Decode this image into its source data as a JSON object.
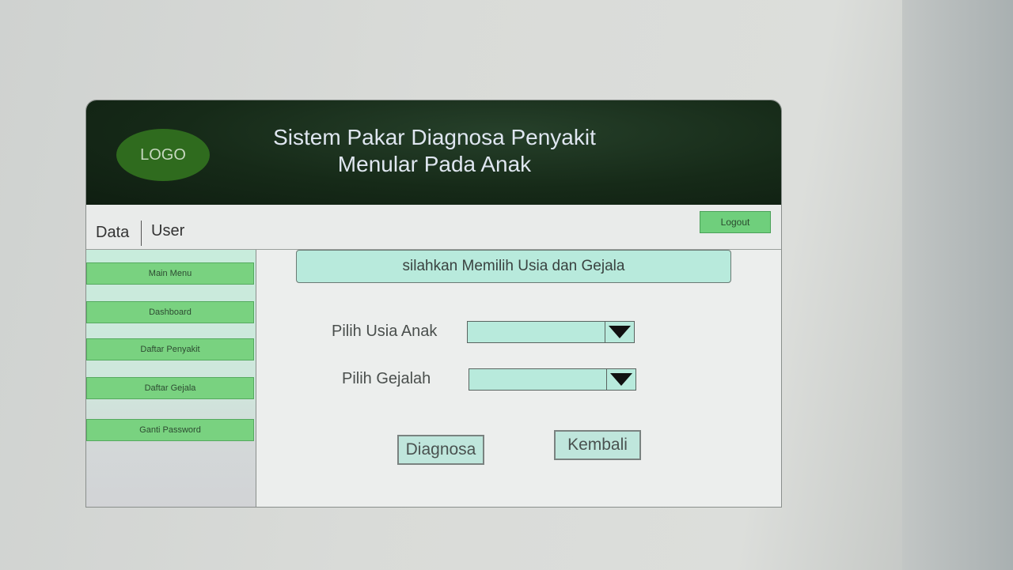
{
  "header": {
    "logo_label": "LOGO",
    "title_line1": "Sistem Pakar Diagnosa Penyakit",
    "title_line2": "Menular Pada Anak"
  },
  "navbar": {
    "data_label": "Data",
    "user_label": "User",
    "logout_label": "Logout"
  },
  "sidebar": {
    "items": [
      {
        "label": "Main Menu"
      },
      {
        "label": "Dashboard"
      },
      {
        "label": "Daftar Penyakit"
      },
      {
        "label": "Daftar Gejala"
      },
      {
        "label": "Ganti Password"
      }
    ]
  },
  "main": {
    "prompt": "silahkan Memilih Usia dan Gejala",
    "age_label": "Pilih Usia Anak",
    "age_value": "",
    "symptom_label": "Pilih Gejalah",
    "symptom_value": "",
    "diagnose_label": "Diagnosa",
    "back_label": "Kembali"
  },
  "colors": {
    "header_bg": "#162a18",
    "logo_green": "#2f6b1e",
    "menu_green": "#79d280",
    "field_mint": "#b8eadc"
  }
}
